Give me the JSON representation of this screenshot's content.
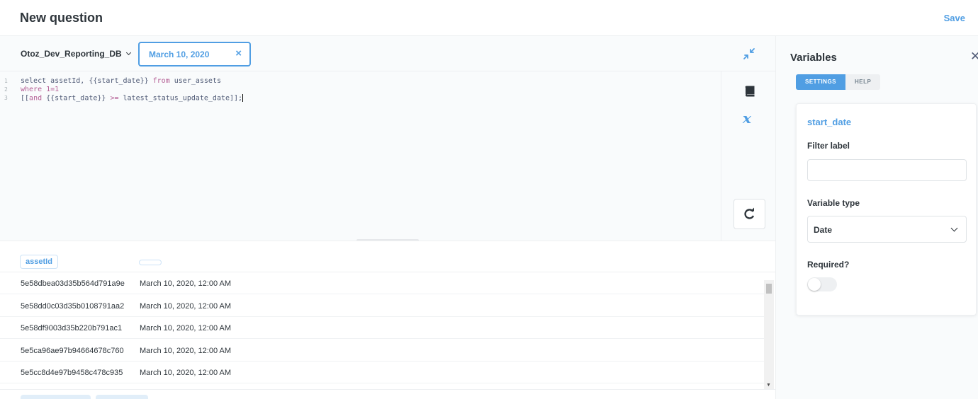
{
  "header": {
    "title": "New question",
    "save_label": "Save"
  },
  "toolbar": {
    "database": "Otoz_Dev_Reporting_DB",
    "date_value": "March 10, 2020",
    "clear_symbol": "×"
  },
  "editor": {
    "lines": [
      {
        "num": "1",
        "tokens": [
          {
            "t": "select assetId, {{start_date}} ",
            "kw": false
          },
          {
            "t": "from",
            "kw": true
          },
          {
            "t": " user_assets",
            "kw": false
          }
        ]
      },
      {
        "num": "2",
        "tokens": [
          {
            "t": "where 1=1",
            "kw": true
          }
        ]
      },
      {
        "num": "3",
        "tokens": [
          {
            "t": "[[",
            "kw": false
          },
          {
            "t": "and",
            "kw": true
          },
          {
            "t": " {{start_date}} ",
            "kw": false
          },
          {
            "t": ">=",
            "kw": true
          },
          {
            "t": " latest_status_update_date]];",
            "kw": false
          }
        ]
      }
    ],
    "variables_icon_glyph": "𝒙"
  },
  "results": {
    "columns": [
      "assetId",
      ""
    ],
    "rows": [
      [
        "5e58dbea03d35b564d791a9e",
        "March 10, 2020, 12:00 AM"
      ],
      [
        "5e58dd0c03d35b0108791aa2",
        "March 10, 2020, 12:00 AM"
      ],
      [
        "5e58df9003d35b220b791ac1",
        "March 10, 2020, 12:00 AM"
      ],
      [
        "5e5ca96ae97b94664678c760",
        "March 10, 2020, 12:00 AM"
      ],
      [
        "5e5cc8d4e97b9458c478c935",
        "March 10, 2020, 12:00 AM"
      ]
    ]
  },
  "sidebar": {
    "title": "Variables",
    "close_symbol": "✕",
    "tabs": [
      {
        "label": "SETTINGS",
        "active": true
      },
      {
        "label": "HELP",
        "active": false
      }
    ],
    "variable_name": "start_date",
    "filter_label_label": "Filter label",
    "filter_label_value": "",
    "variable_type_label": "Variable type",
    "variable_type_value": "Date",
    "required_label": "Required?",
    "required": false
  },
  "colors": {
    "accent": "#509ee3",
    "text": "#2e353b",
    "keyword": "#b35d94"
  }
}
